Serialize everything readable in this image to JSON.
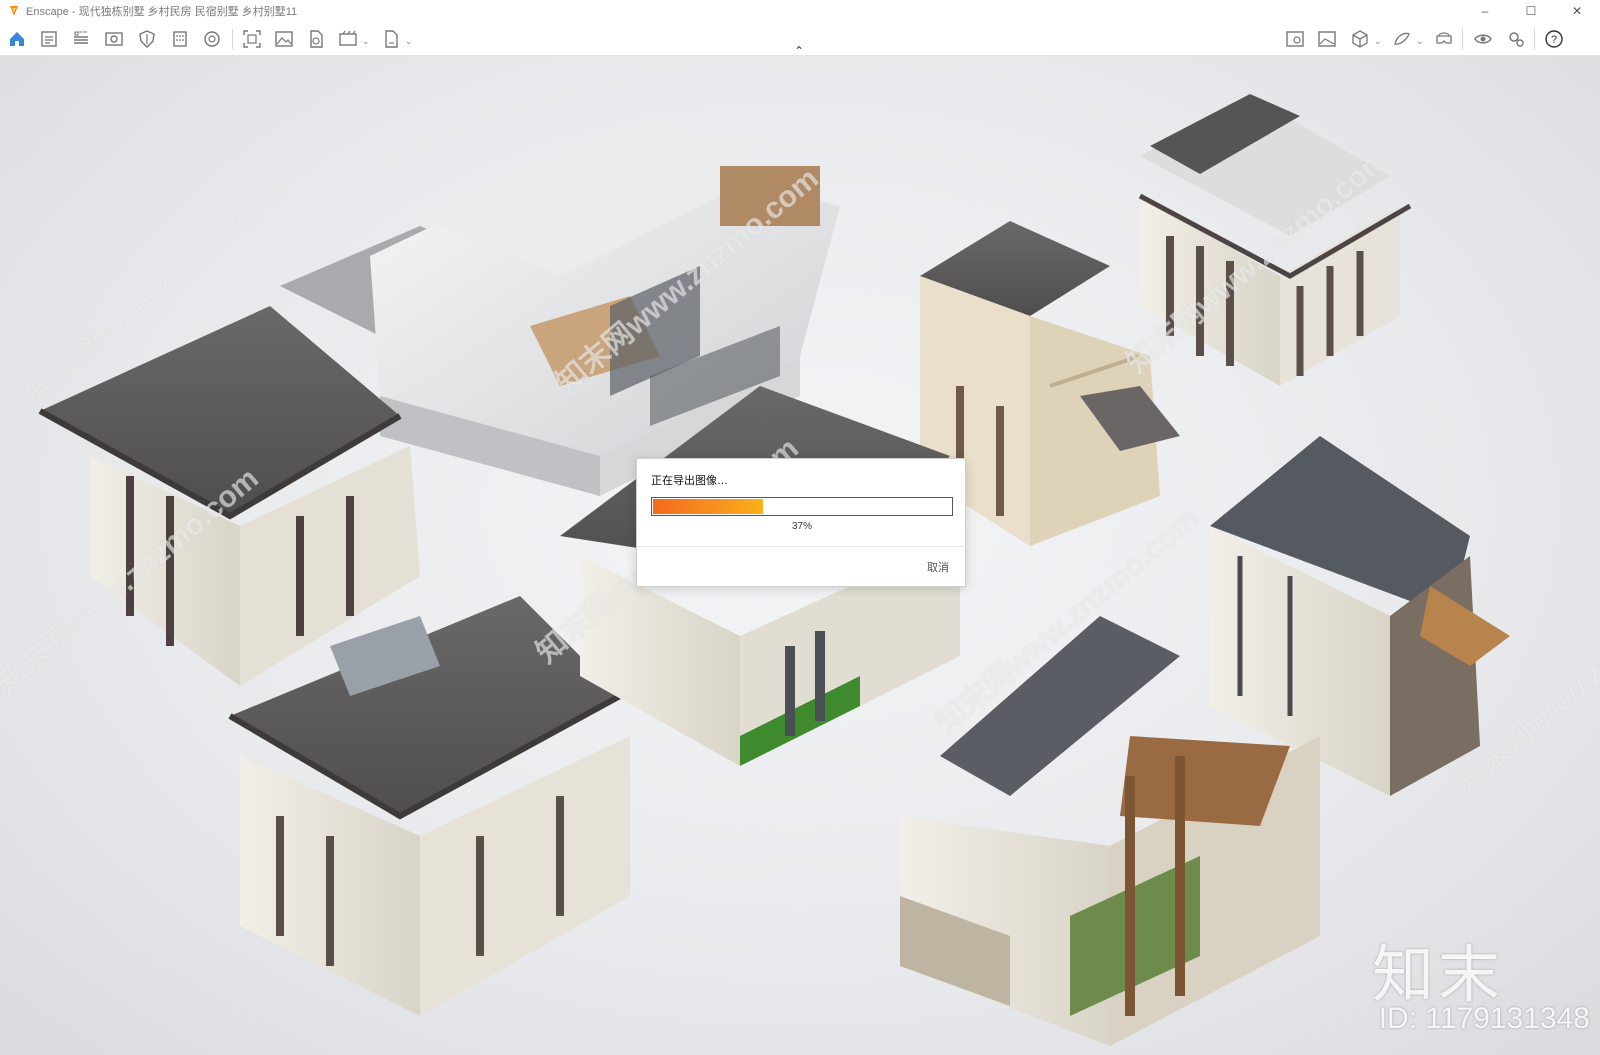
{
  "window": {
    "title": "Enscape - 现代独栋别墅 乡村民房 民宿别墅 乡村别墅11",
    "controls": {
      "minimize": "–",
      "maximize": "☐",
      "close": "✕"
    }
  },
  "toolbar": {
    "left_icons": [
      "home-icon",
      "document-icon",
      "bim-icon",
      "eye-view-icon",
      "shield-icon",
      "building-icon",
      "atom-icon",
      "capture-icon",
      "image-icon",
      "file-icon",
      "video-icon",
      "export-icon"
    ],
    "right_icons": [
      "asset-icon",
      "gallery-icon",
      "cube-icon",
      "material-icon",
      "vr-headset-icon",
      "visual-settings-icon",
      "settings-icon",
      "help-icon"
    ],
    "accent_color": "#3a86d8"
  },
  "viewport": {
    "watermark_text": "知末网www.znzmo.com",
    "brand_logo": "知末",
    "brand_id": "ID: 1179131348"
  },
  "export_dialog": {
    "title": "正在导出图像…",
    "progress": 0.37,
    "progress_label": "37%",
    "cancel_label": "取消",
    "progress_colors": [
      "#f26b1d",
      "#f9b11b"
    ]
  }
}
